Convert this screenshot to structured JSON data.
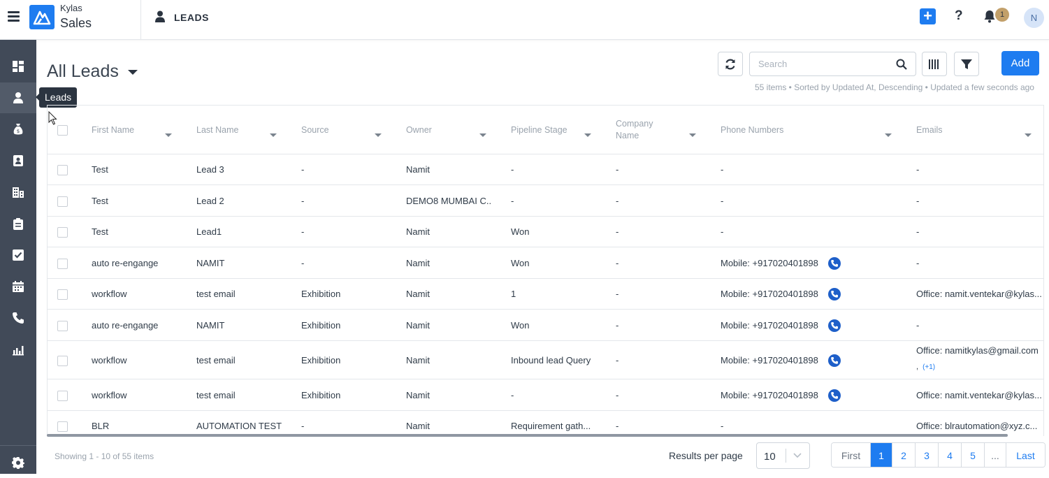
{
  "header": {
    "brand_top": "Kylas",
    "brand_bottom": "Sales",
    "page_label": "LEADS",
    "help_label": "?",
    "notification_count": "1",
    "avatar_initial": "N"
  },
  "sidebar": {
    "items": [
      {
        "name": "dashboard"
      },
      {
        "name": "leads",
        "active": true
      },
      {
        "name": "deals"
      },
      {
        "name": "contacts"
      },
      {
        "name": "companies"
      },
      {
        "name": "tasks-clipboard"
      },
      {
        "name": "tasks-check"
      },
      {
        "name": "calendar"
      },
      {
        "name": "calls"
      },
      {
        "name": "reports"
      }
    ],
    "tooltip": "Leads"
  },
  "toolbar": {
    "title": "All Leads",
    "search_placeholder": "Search",
    "add_label": "Add",
    "meta": "55 items • Sorted by Updated At, Descending • Updated a few seconds ago"
  },
  "table": {
    "columns": [
      "First Name",
      "Last Name",
      "Source",
      "Owner",
      "Pipeline Stage",
      "Company Name",
      "Phone Numbers",
      "Emails"
    ],
    "rows": [
      {
        "first": "Test",
        "last": "Lead 3",
        "source": "-",
        "owner": "Namit",
        "stage": "-",
        "company": "-",
        "phone": "-",
        "email": "-",
        "call": false
      },
      {
        "first": "Test",
        "last": "Lead 2",
        "source": "-",
        "owner": "DEMO8 MUMBAI C...",
        "stage": "-",
        "company": "-",
        "phone": "-",
        "email": "-",
        "call": false
      },
      {
        "first": "Test",
        "last": "Lead1",
        "source": "-",
        "owner": "Namit",
        "stage": "Won",
        "company": "-",
        "phone": "-",
        "email": "-",
        "call": false
      },
      {
        "first": "auto re-engange",
        "last": "NAMIT",
        "source": "-",
        "owner": "Namit",
        "stage": "Won",
        "company": "-",
        "phone": "Mobile: +917020401898",
        "email": "-",
        "call": true
      },
      {
        "first": "workflow",
        "last": "test email",
        "source": "Exhibition",
        "owner": "Namit",
        "stage": "1",
        "company": "-",
        "phone": "Mobile: +917020401898",
        "email": "Office: namit.ventekar@kylas...",
        "call": true
      },
      {
        "first": "auto re-engange",
        "last": "NAMIT",
        "source": "Exhibition",
        "owner": "Namit",
        "stage": "Won",
        "company": "-",
        "phone": "Mobile: +917020401898",
        "email": "-",
        "call": true
      },
      {
        "first": "workflow",
        "last": "test email",
        "source": "Exhibition",
        "owner": "Namit",
        "stage": "Inbound lead Query",
        "company": "-",
        "phone": "Mobile: +917020401898",
        "email": "Office: namitkylas@gmail.com",
        "email_extra_prefix": ",",
        "email_extra": "(+1)",
        "call": true
      },
      {
        "first": "workflow",
        "last": "test email",
        "source": "Exhibition",
        "owner": "Namit",
        "stage": "-",
        "company": "-",
        "phone": "Mobile: +917020401898",
        "email": "Office: namit.ventekar@kylas...",
        "call": true
      },
      {
        "first": "BLR",
        "last": "AUTOMATION TEST",
        "source": "-",
        "owner": "Namit",
        "stage": "Requirement gath...",
        "company": "-",
        "phone": "-",
        "email": "Office: blrautomation@xyz.c...",
        "call": false
      }
    ]
  },
  "footer": {
    "showing": "Showing 1 - 10 of 55 items",
    "rpp_label": "Results per page",
    "rpp_value": "10",
    "pages": [
      "First",
      "1",
      "2",
      "3",
      "4",
      "5",
      "...",
      "Last"
    ],
    "current_page": "1"
  }
}
